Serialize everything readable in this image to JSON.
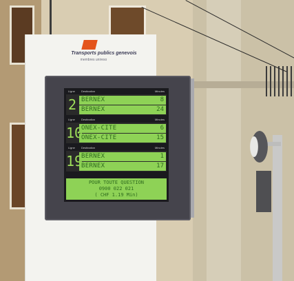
{
  "sign": {
    "brand": "Transports publics genevois",
    "tagline": "membres unireso"
  },
  "display": {
    "column_labels": {
      "line": "Ligne",
      "destination": "Destination",
      "minutes": "Minutes"
    },
    "departures": [
      {
        "line": "2",
        "rows": [
          {
            "dest": "BERNEX",
            "min": "8"
          },
          {
            "dest": "BERNEX",
            "min": "24"
          }
        ]
      },
      {
        "line": "10",
        "rows": [
          {
            "dest": "ONEX-CITE",
            "min": "6"
          },
          {
            "dest": "ONEX-CITE",
            "min": "15"
          }
        ]
      },
      {
        "line": "19",
        "rows": [
          {
            "dest": "BERNEX",
            "min": "1"
          },
          {
            "dest": "BERNEX",
            "min": "17"
          }
        ]
      }
    ],
    "notice": [
      "POUR TOUTE QUESTION",
      "0900 022 021",
      "( CHF 1.19 Min)"
    ]
  },
  "colors": {
    "lcd_green": "#8ed256",
    "lcd_text": "#2f6b1e",
    "housing": "#45444c",
    "brand_orange": "#e4541b"
  }
}
